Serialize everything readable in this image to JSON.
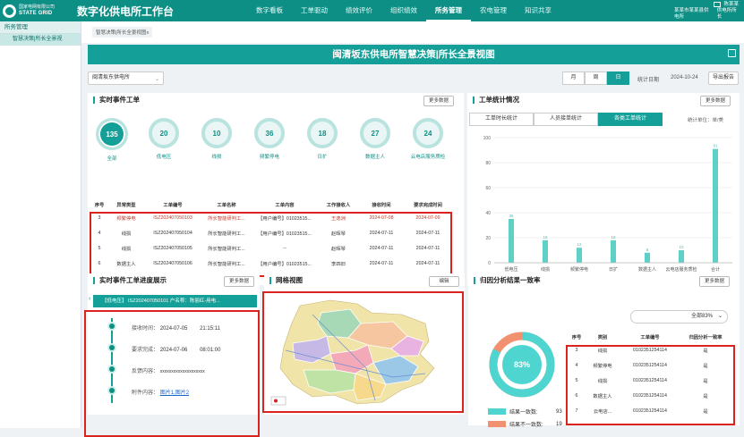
{
  "header": {
    "logo_cn": "国家电网有限公司",
    "logo_en": "STATE GRID",
    "app_title": "数字化供电所工作台",
    "nav": [
      "数字看板",
      "工单驱动",
      "绩效评价",
      "组织绩效",
      "所务管理",
      "农电管理",
      "知识共享"
    ],
    "nav_active_index": 4,
    "user_name": "陈某某",
    "user_org": "某某市某某县供电所",
    "user_role": "供电所所长"
  },
  "sidebar": {
    "group": "所务管理",
    "items": [
      "智慧决策|所长全景视"
    ]
  },
  "tabs": [
    "智慧决策|所长全景视图"
  ],
  "tab_close": "x",
  "banner_title": "闽清坂东供电所智慧决策|所长全景视图",
  "filters": {
    "org": "闽清坂东供电所",
    "periods": [
      "月",
      "周",
      "日"
    ],
    "period_active": 2,
    "date_label": "统计日期",
    "date_value": "2024-10-24",
    "export_label": "导出报告"
  },
  "realtime": {
    "title": "实时事件工单",
    "more": "更多数据",
    "circles": [
      {
        "value": "135",
        "label": "全部"
      },
      {
        "value": "20",
        "label": "低电压"
      },
      {
        "value": "10",
        "label": "线损"
      },
      {
        "value": "36",
        "label": "频繁停电"
      },
      {
        "value": "18",
        "label": "日扩"
      },
      {
        "value": "27",
        "label": "数据主人"
      },
      {
        "value": "24",
        "label": "云电店服务质检"
      }
    ],
    "columns": [
      "序号",
      "异常类型",
      "工单编号",
      "工单名称",
      "工单内容",
      "工作接收人",
      "接收时间",
      "要求完成时间"
    ],
    "rows": [
      [
        "3",
        "频繁停电",
        "ISZ2024070501​03",
        "所长智能研判工...",
        "【用户编号】01023515...",
        "王逸洲",
        "2024-07-08",
        "2024-07-09"
      ],
      [
        "4",
        "线损",
        "ISZ202407050104",
        "所长智能研判工...",
        "【用户编号】01023515...",
        "赵晖琴",
        "2024-07-11",
        "2024-07-11"
      ],
      [
        "5",
        "线损",
        "ISZ202407050105",
        "所长智能研判工...",
        "--",
        "赵晖琴",
        "2024-07-11",
        "2024-07-11"
      ],
      [
        "6",
        "数据主人",
        "ISZ202407050106",
        "所长智能研判工...",
        "【用户编号】01023515...",
        "李四旧",
        "2024-07-11",
        "2024-07-11"
      ]
    ]
  },
  "stats": {
    "title": "工单统计情况",
    "more": "更多数据",
    "seg": [
      "工单时长统计",
      "人员接单统计",
      "各类工单统计"
    ],
    "seg_active": 2,
    "unit_label": "统计单位：单/美"
  },
  "chart_data": {
    "type": "bar",
    "categories": [
      "低电压",
      "线损",
      "频繁停电",
      "日扩",
      "数据主人",
      "云电店服务质检",
      "合计"
    ],
    "values": [
      35,
      18,
      12,
      18,
      8,
      10,
      91
    ],
    "data_labels": [
      "35",
      "18",
      "12",
      "18",
      "8",
      "10",
      "91"
    ],
    "ylim": [
      0,
      100
    ],
    "yticks": [
      0,
      20,
      40,
      60,
      80,
      100
    ],
    "bar_color": "#5fd0c6",
    "grid": true
  },
  "progress": {
    "title": "实时事件工单进度展示",
    "more": "更多数据",
    "header": "【低电压】  ISZ202407050101    户名称：陈丽红-用电...",
    "items": [
      {
        "label": "接收时间：",
        "date": "2024-07-05",
        "time": "21:15:11"
      },
      {
        "label": "要求完成：",
        "date": "2024-07-06",
        "time": "08:01:00"
      },
      {
        "label": "反馈内容：",
        "date": "xxxxxxxxxxxxxxxxxxxx",
        "time": ""
      },
      {
        "label": "附件内容：",
        "date": "图片1,图片2",
        "time": ""
      }
    ]
  },
  "grid_view": {
    "title": "网格视图",
    "edit": "编辑"
  },
  "attribution": {
    "title": "归因分析结果一致率",
    "more": "更多数据",
    "filter": "全部83%",
    "percent_label": "83%",
    "percent": 83,
    "legend": [
      {
        "label": "结果一致数:",
        "value": "93",
        "color": "#4fd5d0"
      },
      {
        "label": "结果不一致数:",
        "value": "19",
        "color": "#f1916f"
      }
    ],
    "columns": [
      "序号",
      "类别",
      "工单编号",
      "归因分析一致率"
    ],
    "rows": [
      [
        "3",
        "线损",
        "0102351254114",
        "是"
      ],
      [
        "4",
        "频繁停电",
        "0102351254114",
        "是"
      ],
      [
        "5",
        "线损",
        "0102351254114",
        "是"
      ],
      [
        "6",
        "数据主人",
        "0102351254114",
        "是"
      ],
      [
        "7",
        "云电店...",
        "0102351254114",
        "是"
      ]
    ]
  }
}
